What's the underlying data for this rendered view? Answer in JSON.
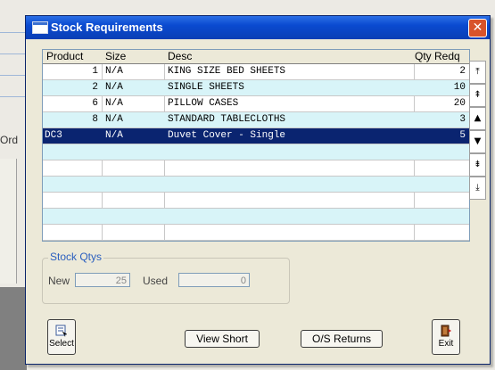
{
  "background": {
    "partial_label": "Ord"
  },
  "window": {
    "title": "Stock Requirements",
    "close_glyph": "✕"
  },
  "grid": {
    "columns": [
      "Product",
      "Size",
      "Desc",
      "Qty Redq"
    ],
    "rows": [
      {
        "product": "1",
        "size": "N/A",
        "desc": "KING SIZE BED SHEETS",
        "qty": "2"
      },
      {
        "product": "2",
        "size": "N/A",
        "desc": "SINGLE SHEETS",
        "qty": "10"
      },
      {
        "product": "6",
        "size": "N/A",
        "desc": "PILLOW CASES",
        "qty": "20"
      },
      {
        "product": "8",
        "size": "N/A",
        "desc": "STANDARD TABLECLOTHS",
        "qty": "3"
      },
      {
        "product": "DC3",
        "size": "N/A",
        "desc": "Duvet Cover - Single",
        "qty": "5"
      }
    ],
    "selected_row": 4
  },
  "nav": {
    "first": "⤒",
    "page_up": "⇞",
    "up": "▲",
    "down": "▼",
    "page_down": "⇟",
    "last": "⤓"
  },
  "stock_qtys": {
    "title": "Stock Qtys",
    "new_label": "New",
    "new_value": "25",
    "used_label": "Used",
    "used_value": "0"
  },
  "buttons": {
    "select": "Select",
    "view_short": "View Short",
    "os_returns": "O/S Returns",
    "exit": "Exit"
  },
  "colors": {
    "title_bar": "#0a4ad0",
    "selection": "#0a2470",
    "alt_row": "#d8f4f8"
  }
}
